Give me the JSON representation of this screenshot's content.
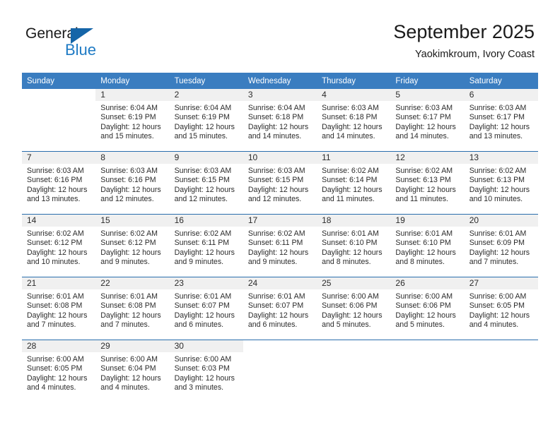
{
  "brand": {
    "word_general": "General",
    "word_blue": "Blue",
    "accent_color": "#1e7ac4",
    "triangle_color": "#1565a8"
  },
  "header": {
    "title": "September 2025",
    "subtitle": "Yaokimkroum, Ivory Coast"
  },
  "calendar": {
    "header_bg": "#3a7dc0",
    "separator_color": "#2a6ead",
    "datestrip_bg": "#f0f0f0",
    "weekday_headers": [
      "Sunday",
      "Monday",
      "Tuesday",
      "Wednesday",
      "Thursday",
      "Friday",
      "Saturday"
    ],
    "weeks": [
      [
        {
          "blank": true
        },
        {
          "date": "1",
          "sunrise": "Sunrise: 6:04 AM",
          "sunset": "Sunset: 6:19 PM",
          "daylight_1": "Daylight: 12 hours",
          "daylight_2": "and 15 minutes."
        },
        {
          "date": "2",
          "sunrise": "Sunrise: 6:04 AM",
          "sunset": "Sunset: 6:19 PM",
          "daylight_1": "Daylight: 12 hours",
          "daylight_2": "and 15 minutes."
        },
        {
          "date": "3",
          "sunrise": "Sunrise: 6:04 AM",
          "sunset": "Sunset: 6:18 PM",
          "daylight_1": "Daylight: 12 hours",
          "daylight_2": "and 14 minutes."
        },
        {
          "date": "4",
          "sunrise": "Sunrise: 6:03 AM",
          "sunset": "Sunset: 6:18 PM",
          "daylight_1": "Daylight: 12 hours",
          "daylight_2": "and 14 minutes."
        },
        {
          "date": "5",
          "sunrise": "Sunrise: 6:03 AM",
          "sunset": "Sunset: 6:17 PM",
          "daylight_1": "Daylight: 12 hours",
          "daylight_2": "and 14 minutes."
        },
        {
          "date": "6",
          "sunrise": "Sunrise: 6:03 AM",
          "sunset": "Sunset: 6:17 PM",
          "daylight_1": "Daylight: 12 hours",
          "daylight_2": "and 13 minutes."
        }
      ],
      [
        {
          "date": "7",
          "sunrise": "Sunrise: 6:03 AM",
          "sunset": "Sunset: 6:16 PM",
          "daylight_1": "Daylight: 12 hours",
          "daylight_2": "and 13 minutes."
        },
        {
          "date": "8",
          "sunrise": "Sunrise: 6:03 AM",
          "sunset": "Sunset: 6:16 PM",
          "daylight_1": "Daylight: 12 hours",
          "daylight_2": "and 12 minutes."
        },
        {
          "date": "9",
          "sunrise": "Sunrise: 6:03 AM",
          "sunset": "Sunset: 6:15 PM",
          "daylight_1": "Daylight: 12 hours",
          "daylight_2": "and 12 minutes."
        },
        {
          "date": "10",
          "sunrise": "Sunrise: 6:03 AM",
          "sunset": "Sunset: 6:15 PM",
          "daylight_1": "Daylight: 12 hours",
          "daylight_2": "and 12 minutes."
        },
        {
          "date": "11",
          "sunrise": "Sunrise: 6:02 AM",
          "sunset": "Sunset: 6:14 PM",
          "daylight_1": "Daylight: 12 hours",
          "daylight_2": "and 11 minutes."
        },
        {
          "date": "12",
          "sunrise": "Sunrise: 6:02 AM",
          "sunset": "Sunset: 6:13 PM",
          "daylight_1": "Daylight: 12 hours",
          "daylight_2": "and 11 minutes."
        },
        {
          "date": "13",
          "sunrise": "Sunrise: 6:02 AM",
          "sunset": "Sunset: 6:13 PM",
          "daylight_1": "Daylight: 12 hours",
          "daylight_2": "and 10 minutes."
        }
      ],
      [
        {
          "date": "14",
          "sunrise": "Sunrise: 6:02 AM",
          "sunset": "Sunset: 6:12 PM",
          "daylight_1": "Daylight: 12 hours",
          "daylight_2": "and 10 minutes."
        },
        {
          "date": "15",
          "sunrise": "Sunrise: 6:02 AM",
          "sunset": "Sunset: 6:12 PM",
          "daylight_1": "Daylight: 12 hours",
          "daylight_2": "and 9 minutes."
        },
        {
          "date": "16",
          "sunrise": "Sunrise: 6:02 AM",
          "sunset": "Sunset: 6:11 PM",
          "daylight_1": "Daylight: 12 hours",
          "daylight_2": "and 9 minutes."
        },
        {
          "date": "17",
          "sunrise": "Sunrise: 6:02 AM",
          "sunset": "Sunset: 6:11 PM",
          "daylight_1": "Daylight: 12 hours",
          "daylight_2": "and 9 minutes."
        },
        {
          "date": "18",
          "sunrise": "Sunrise: 6:01 AM",
          "sunset": "Sunset: 6:10 PM",
          "daylight_1": "Daylight: 12 hours",
          "daylight_2": "and 8 minutes."
        },
        {
          "date": "19",
          "sunrise": "Sunrise: 6:01 AM",
          "sunset": "Sunset: 6:10 PM",
          "daylight_1": "Daylight: 12 hours",
          "daylight_2": "and 8 minutes."
        },
        {
          "date": "20",
          "sunrise": "Sunrise: 6:01 AM",
          "sunset": "Sunset: 6:09 PM",
          "daylight_1": "Daylight: 12 hours",
          "daylight_2": "and 7 minutes."
        }
      ],
      [
        {
          "date": "21",
          "sunrise": "Sunrise: 6:01 AM",
          "sunset": "Sunset: 6:08 PM",
          "daylight_1": "Daylight: 12 hours",
          "daylight_2": "and 7 minutes."
        },
        {
          "date": "22",
          "sunrise": "Sunrise: 6:01 AM",
          "sunset": "Sunset: 6:08 PM",
          "daylight_1": "Daylight: 12 hours",
          "daylight_2": "and 7 minutes."
        },
        {
          "date": "23",
          "sunrise": "Sunrise: 6:01 AM",
          "sunset": "Sunset: 6:07 PM",
          "daylight_1": "Daylight: 12 hours",
          "daylight_2": "and 6 minutes."
        },
        {
          "date": "24",
          "sunrise": "Sunrise: 6:01 AM",
          "sunset": "Sunset: 6:07 PM",
          "daylight_1": "Daylight: 12 hours",
          "daylight_2": "and 6 minutes."
        },
        {
          "date": "25",
          "sunrise": "Sunrise: 6:00 AM",
          "sunset": "Sunset: 6:06 PM",
          "daylight_1": "Daylight: 12 hours",
          "daylight_2": "and 5 minutes."
        },
        {
          "date": "26",
          "sunrise": "Sunrise: 6:00 AM",
          "sunset": "Sunset: 6:06 PM",
          "daylight_1": "Daylight: 12 hours",
          "daylight_2": "and 5 minutes."
        },
        {
          "date": "27",
          "sunrise": "Sunrise: 6:00 AM",
          "sunset": "Sunset: 6:05 PM",
          "daylight_1": "Daylight: 12 hours",
          "daylight_2": "and 4 minutes."
        }
      ],
      [
        {
          "date": "28",
          "sunrise": "Sunrise: 6:00 AM",
          "sunset": "Sunset: 6:05 PM",
          "daylight_1": "Daylight: 12 hours",
          "daylight_2": "and 4 minutes."
        },
        {
          "date": "29",
          "sunrise": "Sunrise: 6:00 AM",
          "sunset": "Sunset: 6:04 PM",
          "daylight_1": "Daylight: 12 hours",
          "daylight_2": "and 4 minutes."
        },
        {
          "date": "30",
          "sunrise": "Sunrise: 6:00 AM",
          "sunset": "Sunset: 6:03 PM",
          "daylight_1": "Daylight: 12 hours",
          "daylight_2": "and 3 minutes."
        },
        {
          "blank": true
        },
        {
          "blank": true
        },
        {
          "blank": true
        },
        {
          "blank": true
        }
      ]
    ]
  }
}
